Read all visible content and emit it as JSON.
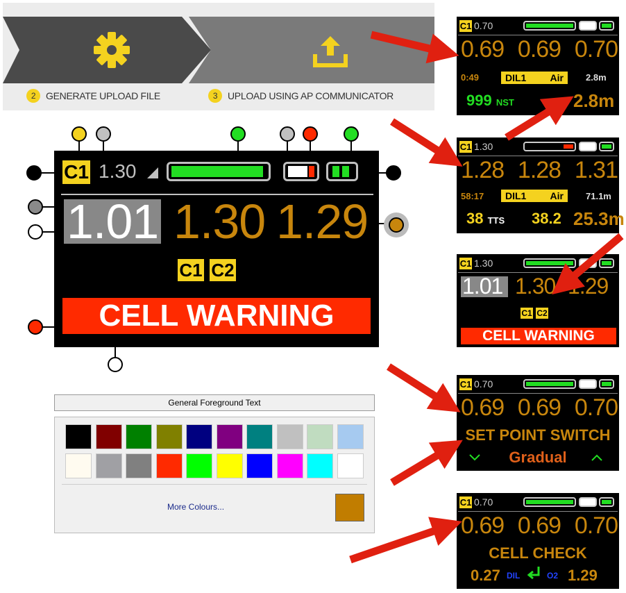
{
  "banner": {
    "step2_num": "2",
    "step2_label": "GENERATE UPLOAD FILE",
    "step3_num": "3",
    "step3_label": "UPLOAD USING AP COMMUNICATOR",
    "icons": [
      "gear-icon",
      "upload-icon"
    ]
  },
  "main_screen": {
    "cell_tag": "C1",
    "setpoint": "1.30",
    "ppo2": [
      "1.01",
      "1.30",
      "1.29"
    ],
    "cell_tags": [
      "C1",
      "C2"
    ],
    "warning": "CELL WARNING"
  },
  "mini_screens": [
    {
      "tag": "C1",
      "setpoint": "0.70",
      "ppo2": [
        "0.69",
        "0.69",
        "0.70"
      ],
      "time": "0:49",
      "gas": "DIL1",
      "diluent": "Air",
      "depth_small": "2.8m",
      "stop_value": "999",
      "stop_label": "NST",
      "depth": "2.8m"
    },
    {
      "tag": "C1",
      "setpoint": "1.30",
      "ppo2": [
        "1.28",
        "1.28",
        "1.31"
      ],
      "time": "58:17",
      "gas": "DIL1",
      "diluent": "Air",
      "depth_small": "71.1m",
      "stop_value": "38",
      "stop_label": "TTS",
      "value2": "38.2",
      "depth": "25.3m"
    },
    {
      "tag": "C1",
      "setpoint": "1.30",
      "ppo2": [
        "1.01",
        "1.30",
        "1.29"
      ],
      "cell_tags": [
        "C1",
        "C2"
      ],
      "warning": "CELL WARNING"
    },
    {
      "tag": "C1",
      "setpoint": "0.70",
      "ppo2": [
        "0.69",
        "0.69",
        "0.70"
      ],
      "title": "SET POINT SWITCH",
      "mode": "Gradual"
    },
    {
      "tag": "C1",
      "setpoint": "0.70",
      "ppo2": [
        "0.69",
        "0.69",
        "0.70"
      ],
      "title": "CELL CHECK",
      "dil_value": "0.27",
      "dil_label": "DIL",
      "o2_label": "O2",
      "o2_value": "1.29"
    }
  ],
  "palette": {
    "title": "General Foreground Text",
    "more_colours": "More Colours...",
    "row1": [
      "#000000",
      "#800000",
      "#008000",
      "#808000",
      "#000080",
      "#800080",
      "#008080",
      "#c0c0c0",
      "#c0dcc0",
      "#a6caf0"
    ],
    "row2": [
      "#fffbf0",
      "#a0a0a4",
      "#808080",
      "#ff2a00",
      "#00ff00",
      "#ffff00",
      "#0000ff",
      "#ff00ff",
      "#00ffff",
      "#ffffff"
    ],
    "selected_color": "#c17d00"
  },
  "colors": {
    "accent_orange": "#c8860d",
    "tag_yellow": "#f4d21f",
    "warning_red": "#ff2a00",
    "battery_green": "#22dd22"
  }
}
